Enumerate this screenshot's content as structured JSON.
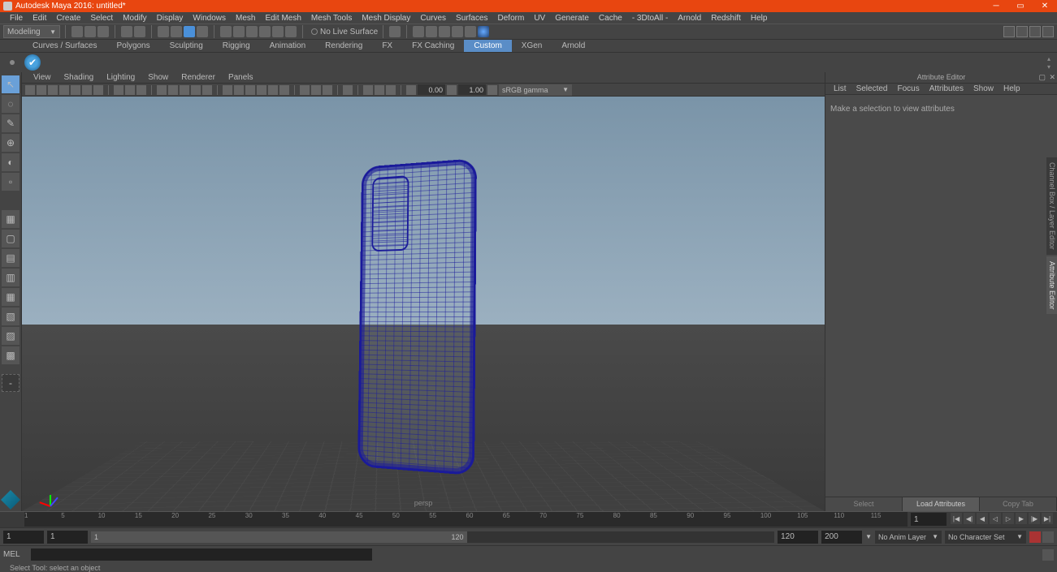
{
  "title": "Autodesk Maya 2016: untitled*",
  "menubar": [
    "File",
    "Edit",
    "Create",
    "Select",
    "Modify",
    "Display",
    "Windows",
    "Mesh",
    "Edit Mesh",
    "Mesh Tools",
    "Mesh Display",
    "Curves",
    "Surfaces",
    "Deform",
    "UV",
    "Generate",
    "Cache",
    "- 3DtoAll -",
    "Arnold",
    "Redshift",
    "Help"
  ],
  "workspace": "Modeling",
  "no_live_surface": "No Live Surface",
  "shelf_tabs": [
    "Curves / Surfaces",
    "Polygons",
    "Sculpting",
    "Rigging",
    "Animation",
    "Rendering",
    "FX",
    "FX Caching",
    "Custom",
    "XGen",
    "Arnold"
  ],
  "shelf_active": "Custom",
  "vp_menu": [
    "View",
    "Shading",
    "Lighting",
    "Show",
    "Renderer",
    "Panels"
  ],
  "vp_num1": "0.00",
  "vp_num2": "1.00",
  "vp_gamma": "sRGB gamma",
  "camera_label": "persp",
  "attr_title": "Attribute Editor",
  "attr_menu": [
    "List",
    "Selected",
    "Focus",
    "Attributes",
    "Show",
    "Help"
  ],
  "attr_hint": "Make a selection to view attributes",
  "attr_buttons": {
    "select": "Select",
    "load": "Load Attributes",
    "copy": "Copy Tab"
  },
  "vert_tabs": [
    "Channel Box / Layer Editor",
    "Attribute Editor"
  ],
  "timeline": {
    "start_frame": "1",
    "current": "1",
    "end": "120",
    "ticks": [
      "1",
      "5",
      "10",
      "15",
      "20",
      "25",
      "30",
      "35",
      "40",
      "45",
      "50",
      "55",
      "60",
      "65",
      "70",
      "75",
      "80",
      "85",
      "90",
      "95",
      "100",
      "105",
      "110",
      "115"
    ]
  },
  "range": {
    "start": "1",
    "inner_start": "1",
    "inner_end": "120",
    "outer_end": "120",
    "outer_end2": "200"
  },
  "anim_layer": "No Anim Layer",
  "char_set": "No Character Set",
  "cmd_label": "MEL",
  "help_line": "Select Tool: select an object"
}
